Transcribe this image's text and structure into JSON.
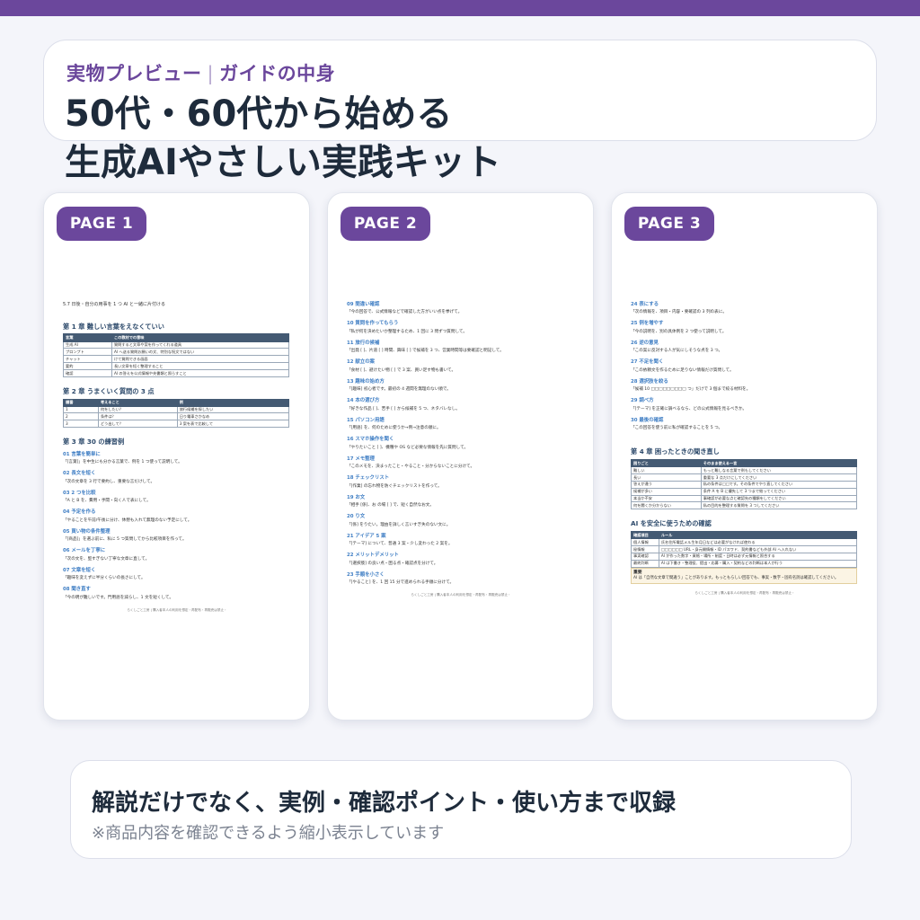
{
  "header": {
    "eyebrow_left": "実物プレビュー",
    "eyebrow_sep": "|",
    "eyebrow_right": "ガイドの中身",
    "title_line1": "50代・60代から始める",
    "title_line2": "生成AIやさしい実践キット"
  },
  "pages": [
    {
      "badge": "PAGE 1",
      "note": "5.7 日後・自分の用事を 1 つ AI と一緒に片付ける",
      "blocks": [
        {
          "type": "h",
          "text": "第 1 章 難しい言葉をえなくていい"
        },
        {
          "type": "table",
          "headers": [
            "言葉",
            "この教材での意味"
          ],
          "rows": [
            [
              "生成 AI",
              "質問すると文章や案を作ってくれる道具"
            ],
            [
              "プロンプト",
              "AI へ送る質問お願いの文、特別な呪文ではない"
            ],
            [
              "チャット",
              "けて質問できる画面"
            ],
            [
              "要約",
              "長い文章を短く整理すること"
            ],
            [
              "確認",
              "AI の答えを公式情報や先書類と照らすこと"
            ]
          ]
        },
        {
          "type": "h",
          "text": "第 2 章 うまくいく質問の 3 点"
        },
        {
          "type": "table",
          "headers": [
            "順番",
            "考えること",
            "例"
          ],
          "rows": [
            [
              "1",
              "何をしたい？",
              "旅行候補を探したい"
            ],
            [
              "2",
              "条件は？",
              "日り電車さかなめ"
            ],
            [
              "3",
              "どう出して？",
              "3 案を表で比較して"
            ]
          ]
        },
        {
          "type": "h",
          "text": "第 3 章 30 の練習例"
        },
        {
          "type": "sh",
          "text": "01 言葉を簡単に"
        },
        {
          "type": "t",
          "text": "「[言葉]」を中生にも分かる言葉で、例を 1 つ使って説明して。"
        },
        {
          "type": "sh",
          "text": "02 長文を短く"
        },
        {
          "type": "t",
          "text": "「次の文章を 3 行で要約し、重要な言だけして。"
        },
        {
          "type": "sh",
          "text": "03 2 つを比較"
        },
        {
          "type": "t",
          "text": "「A と B を、費用・手間・向く人で表にして。"
        },
        {
          "type": "sh",
          "text": "04 予定を作る"
        },
        {
          "type": "t",
          "text": "「やることを午前/午後に分け、休憩も入れて無理のない予定にして。"
        },
        {
          "type": "sh",
          "text": "05 買い物の条件整理"
        },
        {
          "type": "t",
          "text": "「[商品]」を選ぶ前に、私に 5 つ質問してから比較項目を作って。"
        },
        {
          "type": "sh",
          "text": "06 メールを丁寧に"
        },
        {
          "type": "t",
          "text": "「次の文を、堅すぎない丁寧な文章に直して。"
        },
        {
          "type": "sh",
          "text": "07 文章を短く"
        },
        {
          "type": "t",
          "text": "「趣味を変えずに半分くらいの長さにして。"
        },
        {
          "type": "sh",
          "text": "08 聞き直す"
        },
        {
          "type": "t",
          "text": "「今の明が難しいです。門用語を減らし、1 文を短くして。"
        },
        {
          "type": "foot",
          "text": "らくしごと工房 | 購入者本人の利用を想定・再配布・再販売は禁止・"
        }
      ]
    },
    {
      "badge": "PAGE 2",
      "blocks": [
        {
          "type": "sh",
          "text": "09 間違い確認"
        },
        {
          "type": "t",
          "text": "「今の回答で、公式情報などで確認した方がいい点を挙げて。"
        },
        {
          "type": "sh",
          "text": "10 質問を作ってもらう"
        },
        {
          "type": "t",
          "text": "「私が何を決めたいか整理するため、1 回に 3 問ずつ質問して。"
        },
        {
          "type": "sh",
          "text": "11 旅行の候補"
        },
        {
          "type": "t",
          "text": "「出発 [ ]、片道 [ ] 時間、興味 [ ] で候補を 3 つ、営業時間等は要確認と明記して。"
        },
        {
          "type": "sh",
          "text": "12 献立の案"
        },
        {
          "type": "t",
          "text": "「食材 [ ]、避けたい物 [ ] で 3 案、買い足す物も書いて。"
        },
        {
          "type": "sh",
          "text": "13 趣味の始め方"
        },
        {
          "type": "t",
          "text": "「[趣味] 初心者です。最初の 4 週間を無理のない順で。"
        },
        {
          "type": "sh",
          "text": "14 本の選び方"
        },
        {
          "type": "t",
          "text": "「好きな作品 [ ]、苦手 [ ] から候補を 5 つ、ネタバレなし。"
        },
        {
          "type": "sh",
          "text": "15 パソコン用語"
        },
        {
          "type": "t",
          "text": "「[用語] を、何のために使うか→例→注意の順に。"
        },
        {
          "type": "sh",
          "text": "16 スマホ操作を聞く"
        },
        {
          "type": "t",
          "text": "「やりたいこと [ ]、機種や OS など必要な情報を先に質問して。"
        },
        {
          "type": "sh",
          "text": "17 メモ整理"
        },
        {
          "type": "t",
          "text": "「このメモを、決まったこと・やること・分からないことに分けて。"
        },
        {
          "type": "sh",
          "text": "18 チェックリスト"
        },
        {
          "type": "t",
          "text": "「[作業] の忘れ物を防ぐチェックリストを作って。"
        },
        {
          "type": "sh",
          "text": "19 お文"
        },
        {
          "type": "t",
          "text": "「相手 [係]、お の場 [ ] で、短く自然なお文。"
        },
        {
          "type": "sh",
          "text": "20 り文"
        },
        {
          "type": "t",
          "text": "「[係] をりたい。理由を詳しく言いすぎ失のない文に。"
        },
        {
          "type": "sh",
          "text": "21 アイデア 5 案"
        },
        {
          "type": "t",
          "text": "「[テーマ] について、普通 3 案・少し変わった 2 案を。"
        },
        {
          "type": "sh",
          "text": "22 メリットデメリット"
        },
        {
          "type": "t",
          "text": "「[選択肢] の良い点・困る点・確認点を分けて。"
        },
        {
          "type": "sh",
          "text": "23 手順を小さく"
        },
        {
          "type": "t",
          "text": "「[やること] を、1 回 15 分で進められる手順に分けて。"
        },
        {
          "type": "foot",
          "text": "らくしごと工房 | 購入者本人の利用を想定・再配布・再販売は禁止・"
        }
      ]
    },
    {
      "badge": "PAGE 3",
      "blocks": [
        {
          "type": "sh",
          "text": "24 表にする"
        },
        {
          "type": "t",
          "text": "「次の情報を、項目・内容・要確認の 3 列の表に。"
        },
        {
          "type": "sh",
          "text": "25 例を増やす"
        },
        {
          "type": "t",
          "text": "「今の説明を、別の具体例を 2 つ使って説明して。"
        },
        {
          "type": "sh",
          "text": "26 逆の意見"
        },
        {
          "type": "t",
          "text": "「この案に反対する人が気にしそうな点を 3 つ。"
        },
        {
          "type": "sh",
          "text": "27 不足を聞く"
        },
        {
          "type": "t",
          "text": "「この依頼文を作るために足りない情報だけ質問して。"
        },
        {
          "type": "sh",
          "text": "28 選択肢を絞る"
        },
        {
          "type": "t",
          "text": "「候補 10 □□□□□□□□□ つ」だけで 3 個まで絞る材料を。"
        },
        {
          "type": "sh",
          "text": "29 調べ方"
        },
        {
          "type": "t",
          "text": "「[テーマ] を正確に調べるなら、どの公式情報を見るべきか。"
        },
        {
          "type": "sh",
          "text": "30 最後の確認"
        },
        {
          "type": "t",
          "text": "「この回答を使う前に私が確認することを 5 つ。"
        },
        {
          "type": "gap"
        },
        {
          "type": "h",
          "text": "第 4 章 困ったときの聞き直し"
        },
        {
          "type": "table",
          "headers": [
            "困りごと",
            "そのまま使える一言"
          ],
          "rows": [
            [
              "難しい",
              "もっと難しなる言葉で例もしてください"
            ],
            [
              "長い",
              "重要な 3 点だけにしてください"
            ],
            [
              "答えが違う",
              "私の条件は□□です。その条件でやり直してください"
            ],
            [
              "候補が多い",
              "条件 A を B に優先して 3 つまで絞ってください"
            ],
            [
              "本当か不安",
              "事確認が必要な点と確認先の種類をしてください"
            ],
            [
              "何を聞くか分からない",
              "私の目的を整理する質問を 3 つしてください"
            ]
          ]
        },
        {
          "type": "h",
          "text": "AI を安全に使うための確認"
        },
        {
          "type": "table",
          "headers": [
            "確認項目",
            "ルール"
          ],
          "rows": [
            [
              "個人情報",
              "氏名住所電話メル生年月日などは必要がなければ使わる"
            ],
            [
              "秘情報",
              "□□□□□□ URL・身元開情報・ID パスワド、契約書なども外部 AI へ入れない"
            ],
            [
              "事実確認",
              "AI が作った数字・資格・場所・制度・日時は必ず元情報と照合する"
            ],
            [
              "最終判断",
              "AI は下書き・整理役、提出・応募・購入・契約などの判断は本人が行う"
            ]
          ]
        },
        {
          "type": "important",
          "title": "重要",
          "text": "AI は「自然な文章で間違う」ことがあります。もっともらしい回答でも、事実・数字・固有名詞は確認してください。"
        },
        {
          "type": "foot",
          "text": "らくしごと工房 | 購入者本人の利用を想定・再配布・再販売は禁止・"
        }
      ]
    }
  ],
  "footer": {
    "main": "解説だけでなく、実例・確認ポイント・使い方まで収録",
    "sub": "※商品内容を確認できるよう縮小表示しています"
  }
}
